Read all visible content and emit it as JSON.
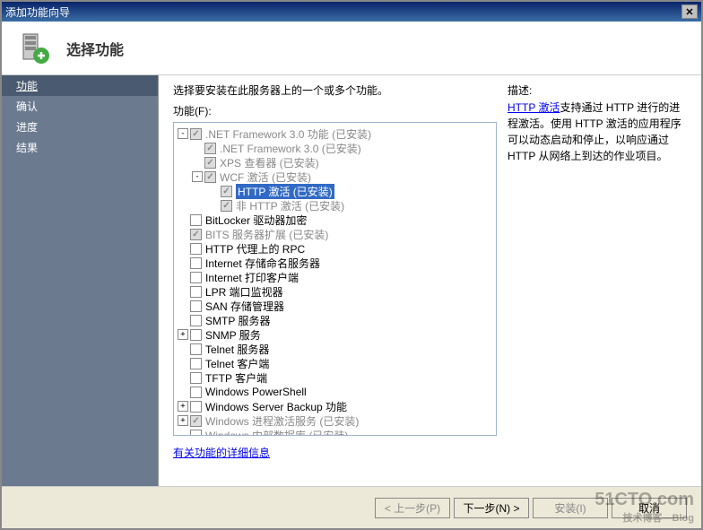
{
  "window": {
    "title": "添加功能向导"
  },
  "header": {
    "title": "选择功能"
  },
  "sidebar": {
    "items": [
      {
        "label": "功能",
        "active": true
      },
      {
        "label": "确认",
        "active": false
      },
      {
        "label": "进度",
        "active": false
      },
      {
        "label": "结果",
        "active": false
      }
    ]
  },
  "main": {
    "instruction": "选择要安装在此服务器上的一个或多个功能。",
    "features_label": "功能(F):",
    "link": "有关功能的详细信息",
    "tree": [
      {
        "indent": 0,
        "expander": "-",
        "checkbox": "disabled-checked",
        "label": ".NET Framework 3.0 功能",
        "suffix": "(已安装)",
        "installed": true
      },
      {
        "indent": 1,
        "expander": "",
        "checkbox": "disabled-checked",
        "label": ".NET Framework 3.0",
        "suffix": "(已安装)",
        "installed": true
      },
      {
        "indent": 1,
        "expander": "",
        "checkbox": "disabled-checked",
        "label": "XPS 查看器",
        "suffix": "(已安装)",
        "installed": true
      },
      {
        "indent": 1,
        "expander": "-",
        "checkbox": "disabled-checked",
        "label": "WCF 激活",
        "suffix": "(已安装)",
        "installed": true
      },
      {
        "indent": 2,
        "expander": "",
        "checkbox": "disabled-checked",
        "label": "HTTP 激活",
        "suffix": "(已安装)",
        "installed": true,
        "selected": true
      },
      {
        "indent": 2,
        "expander": "",
        "checkbox": "disabled-checked",
        "label": "非 HTTP 激活",
        "suffix": "(已安装)",
        "installed": true
      },
      {
        "indent": 0,
        "expander": "",
        "checkbox": "unchecked",
        "label": "BitLocker 驱动器加密",
        "suffix": ""
      },
      {
        "indent": 0,
        "expander": "",
        "checkbox": "disabled-checked",
        "label": "BITS 服务器扩展",
        "suffix": "(已安装)",
        "installed": true
      },
      {
        "indent": 0,
        "expander": "",
        "checkbox": "unchecked",
        "label": "HTTP 代理上的 RPC",
        "suffix": ""
      },
      {
        "indent": 0,
        "expander": "",
        "checkbox": "unchecked",
        "label": "Internet 存储命名服务器",
        "suffix": ""
      },
      {
        "indent": 0,
        "expander": "",
        "checkbox": "unchecked",
        "label": "Internet 打印客户端",
        "suffix": ""
      },
      {
        "indent": 0,
        "expander": "",
        "checkbox": "unchecked",
        "label": "LPR 端口监视器",
        "suffix": ""
      },
      {
        "indent": 0,
        "expander": "",
        "checkbox": "unchecked",
        "label": "SAN 存储管理器",
        "suffix": ""
      },
      {
        "indent": 0,
        "expander": "",
        "checkbox": "unchecked",
        "label": "SMTP 服务器",
        "suffix": ""
      },
      {
        "indent": 0,
        "expander": "+",
        "checkbox": "unchecked",
        "label": "SNMP 服务",
        "suffix": ""
      },
      {
        "indent": 0,
        "expander": "",
        "checkbox": "unchecked",
        "label": "Telnet 服务器",
        "suffix": ""
      },
      {
        "indent": 0,
        "expander": "",
        "checkbox": "unchecked",
        "label": "Telnet 客户端",
        "suffix": ""
      },
      {
        "indent": 0,
        "expander": "",
        "checkbox": "unchecked",
        "label": "TFTP 客户端",
        "suffix": ""
      },
      {
        "indent": 0,
        "expander": "",
        "checkbox": "unchecked",
        "label": "Windows PowerShell",
        "suffix": ""
      },
      {
        "indent": 0,
        "expander": "+",
        "checkbox": "unchecked",
        "label": "Windows Server Backup 功能",
        "suffix": ""
      },
      {
        "indent": 0,
        "expander": "+",
        "checkbox": "disabled-checked",
        "label": "Windows 进程激活服务",
        "suffix": "(已安装)",
        "installed": true
      },
      {
        "indent": 0,
        "expander": "",
        "checkbox": "unchecked",
        "label": "Windows 内部数据库",
        "suffix": "(已安装)",
        "installed": true
      }
    ]
  },
  "description": {
    "title": "描述:",
    "link_text": "HTTP 激活",
    "body": "支持通过 HTTP 进行的进程激活。使用 HTTP 激活的应用程序可以动态启动和停止，以响应通过 HTTP 从网络上到达的作业项目。"
  },
  "footer": {
    "prev": "< 上一步(P)",
    "next": "下一步(N) >",
    "install": "安装(I)",
    "cancel": "取消"
  },
  "watermark": {
    "main": "51CTO.com",
    "sub": "技术博客—Blog"
  }
}
